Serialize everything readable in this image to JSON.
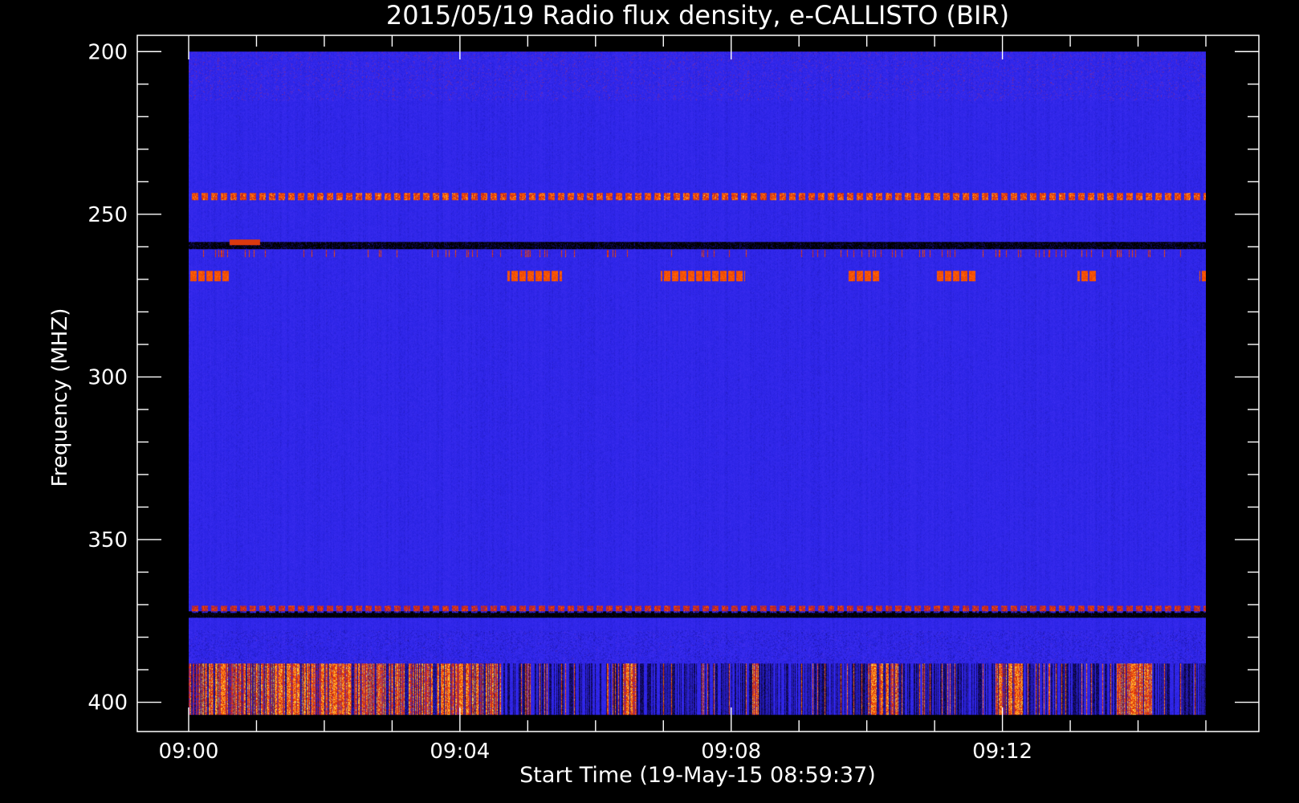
{
  "chart_data": {
    "type": "heatmap",
    "title": "2015/05/19  Radio flux density, e-CALLISTO (BIR)",
    "xlabel": "Start Time (19-May-15 08:59:37)",
    "ylabel": "Frequency (MHZ)",
    "x_tick_labels": [
      "09:00",
      "09:04",
      "09:08",
      "09:12"
    ],
    "x_tick_values_min": [
      0,
      4,
      8,
      12
    ],
    "x_minor_step_min": 1,
    "xlim_min": [
      0,
      15
    ],
    "y_tick_labels": [
      "200",
      "250",
      "300",
      "350",
      "400"
    ],
    "y_tick_values": [
      200,
      250,
      300,
      350,
      400
    ],
    "y_minor_step": 10,
    "ylim": [
      200,
      404
    ],
    "y_axis_range": [
      195,
      409
    ],
    "y_inverted": true,
    "grid": false,
    "colormap": [
      "#000000",
      "#1a0f8c",
      "#2b24e6",
      "#3f2ef2",
      "#c0201a",
      "#ff5a00",
      "#ffd84a"
    ],
    "background_color": "#000000",
    "foreground_color": "#ffffff",
    "features": {
      "bands": [
        {
          "freq": 244.5,
          "intensity": 0.55,
          "style": "dashed"
        },
        {
          "freq": 259.5,
          "intensity": -0.5,
          "style": "dark"
        },
        {
          "freq": 262,
          "intensity": 0.4,
          "style": "ticks"
        },
        {
          "freq": 373,
          "intensity": -0.6,
          "style": "dark"
        },
        {
          "freq": 371.5,
          "intensity": 0.45,
          "style": "dashed"
        }
      ],
      "intermittent_270MHz_bursts": [
        {
          "freq": 269,
          "t_start": 0.0,
          "t_end": 0.6
        },
        {
          "freq": 269,
          "t_start": 4.7,
          "t_end": 5.5
        },
        {
          "freq": 269,
          "t_start": 6.95,
          "t_end": 8.2
        },
        {
          "freq": 269,
          "t_start": 9.7,
          "t_end": 10.2
        },
        {
          "freq": 269,
          "t_start": 11.0,
          "t_end": 11.6
        },
        {
          "freq": 269,
          "t_start": 13.1,
          "t_end": 13.4
        },
        {
          "freq": 269,
          "t_start": 14.9,
          "t_end": 15.0
        }
      ],
      "burst_259MHz": {
        "freq": 258.5,
        "t_start": 0.6,
        "t_end": 1.05
      },
      "low_band_emission": {
        "freq_range": [
          388,
          404
        ],
        "bright_intervals": [
          [
            0.0,
            4.6
          ],
          [
            6.4,
            6.6
          ],
          [
            8.3,
            8.4
          ],
          [
            10.0,
            10.5
          ],
          [
            11.9,
            12.3
          ],
          [
            13.7,
            14.2
          ]
        ]
      }
    }
  }
}
